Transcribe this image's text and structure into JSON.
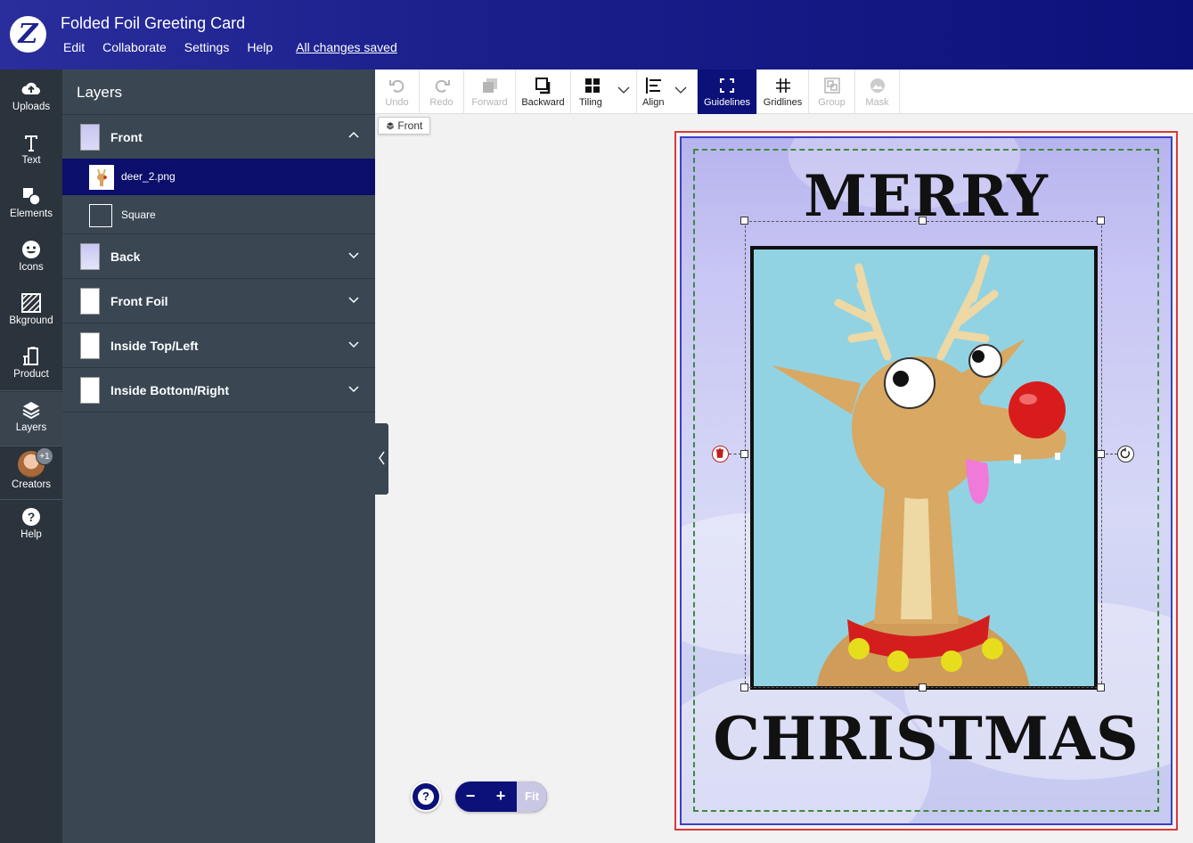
{
  "header": {
    "title": "Folded Foil Greeting Card",
    "menu": [
      "Edit",
      "Collaborate",
      "Settings",
      "Help"
    ],
    "save_status": "All changes saved"
  },
  "rail": {
    "items": [
      {
        "label": "Uploads",
        "icon": "cloud-upload-icon"
      },
      {
        "label": "Text",
        "icon": "text-icon"
      },
      {
        "label": "Elements",
        "icon": "elements-icon"
      },
      {
        "label": "Icons",
        "icon": "smiley-icon"
      },
      {
        "label": "Bkground",
        "icon": "background-icon"
      },
      {
        "label": "Product",
        "icon": "product-icon"
      },
      {
        "label": "Layers",
        "icon": "layers-icon"
      },
      {
        "label": "Creators",
        "icon": "avatar"
      },
      {
        "label": "Help",
        "icon": "help-icon"
      }
    ],
    "creators_badge": "+1"
  },
  "layers_panel": {
    "title": "Layers",
    "groups": [
      {
        "label": "Front",
        "expanded": true,
        "children": [
          {
            "label": "deer_2.png",
            "selected": true
          },
          {
            "label": "Square",
            "selected": false
          }
        ]
      },
      {
        "label": "Back",
        "expanded": false
      },
      {
        "label": "Front Foil",
        "expanded": false
      },
      {
        "label": "Inside Top/Left",
        "expanded": false
      },
      {
        "label": "Inside Bottom/Right",
        "expanded": false
      }
    ]
  },
  "toolbar": {
    "tools": [
      {
        "label": "Undo",
        "state": "disabled",
        "icon": "undo-icon"
      },
      {
        "label": "Redo",
        "state": "disabled",
        "icon": "redo-icon"
      },
      {
        "label": "Forward",
        "state": "disabled",
        "icon": "forward-icon"
      },
      {
        "label": "Backward",
        "state": "enabled",
        "icon": "backward-icon"
      },
      {
        "label": "Tiling",
        "state": "enabled",
        "icon": "tiling-icon"
      },
      {
        "label": "Align",
        "state": "enabled",
        "icon": "align-icon"
      },
      {
        "label": "Guidelines",
        "state": "active",
        "icon": "guidelines-icon"
      },
      {
        "label": "Gridlines",
        "state": "enabled",
        "icon": "gridlines-icon"
      },
      {
        "label": "Group",
        "state": "disabled",
        "icon": "group-icon"
      },
      {
        "label": "Mask",
        "state": "disabled",
        "icon": "mask-icon"
      }
    ]
  },
  "canvas": {
    "side_tag": "Front",
    "card_text_top": "MERRY",
    "card_text_bottom": "CHRISTMAS",
    "colors": {
      "bleed": "#d83a3a",
      "trim": "#3d3fc8",
      "safe": "#3d8a3a",
      "frame_fill": "#92d3e3"
    }
  },
  "zoom": {
    "minus": "−",
    "plus": "+",
    "fit": "Fit",
    "help": "?"
  },
  "colors": {
    "brand": "#0c117a",
    "rail": "#2b333c",
    "panel": "#3a4753",
    "selected_row": "#0b0e6b"
  }
}
